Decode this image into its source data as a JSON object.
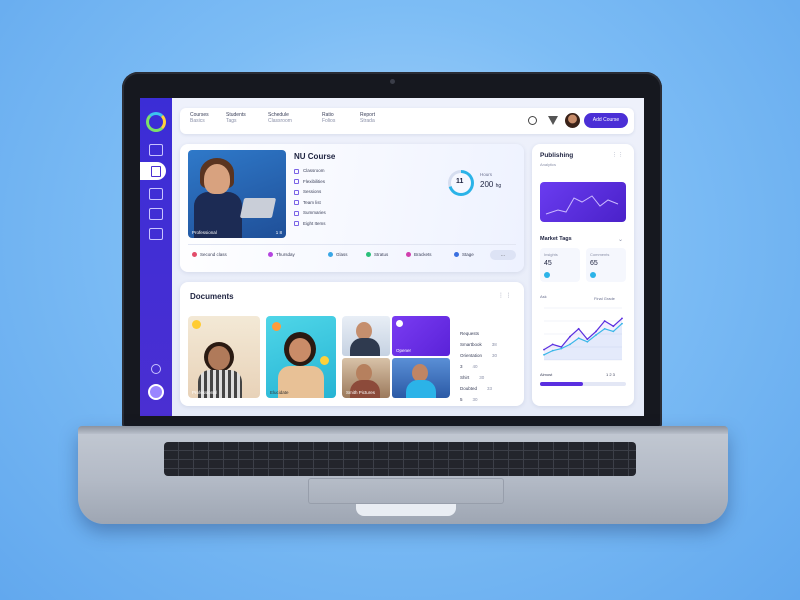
{
  "colors": {
    "background": "#7dbdf5",
    "sidebar": "#4a2fd2",
    "accent": "#4b2fd6",
    "ring": "#2bb3e8"
  },
  "topbar": {
    "nav": [
      {
        "label": "Courses",
        "sub": "Basics"
      },
      {
        "label": "Students",
        "sub": "Tags"
      },
      {
        "label": "Schedule",
        "sub": "Classroom"
      },
      {
        "label": "Ratio",
        "sub": "Folios"
      },
      {
        "label": "Report",
        "sub": "Strada"
      }
    ],
    "icons": [
      "search-icon",
      "filter-icon"
    ],
    "button_label": "Add Course"
  },
  "course": {
    "title": "NU Course",
    "photo_caption": "Professional",
    "photo_caption_right": "1 8",
    "list": [
      "Classroom",
      "Flexibilities",
      "Sessions",
      "Team list",
      "Summaries",
      "Eight Items"
    ],
    "progress_value": "11",
    "progress": 0.7,
    "stat_label": "Hours",
    "stat_value": "200",
    "stat_unit": "hg",
    "chips": [
      {
        "label": "Second class",
        "color": "#e24d6a"
      },
      {
        "label": "Thursday",
        "color": "#b545e0"
      },
      {
        "label": "Glass",
        "color": "#3aa7e6"
      },
      {
        "label": "Stratus",
        "color": "#2bc07a"
      },
      {
        "label": "Brackets",
        "color": "#d13fae"
      },
      {
        "label": "Stage",
        "color": "#3a6fe0"
      }
    ],
    "chip_more": "..."
  },
  "documents": {
    "title": "Documents",
    "thumb_captions": [
      "Professional",
      "Elucidate",
      "Smith Pictures"
    ],
    "thumb_caption_screen": "Opener",
    "list": [
      {
        "name": "Requests",
        "count": ""
      },
      {
        "name": "Smartbook",
        "count": "38"
      },
      {
        "name": "Orientation",
        "count": "30"
      },
      {
        "name": "3",
        "count": "40"
      },
      {
        "name": "Shirt",
        "count": "30"
      },
      {
        "name": "Doubted",
        "count": "33"
      },
      {
        "name": "5",
        "count": "30"
      }
    ]
  },
  "right": {
    "title": "Publishing",
    "subtitle": "Analytics",
    "section": "Market Tags",
    "stat_left": {
      "label": "Insights",
      "value": "45"
    },
    "stat_right": {
      "label": "Comments",
      "value": "65"
    },
    "chart_label": "Ask",
    "chart_legend": "Final Grade",
    "bar_label": "Almost",
    "bar_label_right": "1 2 3",
    "bar_progress": 0.5
  },
  "chart_data": {
    "type": "line",
    "title": "",
    "xlabel": "",
    "ylabel": "",
    "x": [
      1,
      2,
      3,
      4,
      5,
      6,
      7,
      8,
      9,
      10
    ],
    "series": [
      {
        "values": [
          20,
          30,
          25,
          45,
          60,
          40,
          55,
          75,
          65,
          80
        ],
        "color": "#5a2fe0"
      },
      {
        "values": [
          10,
          18,
          22,
          30,
          42,
          35,
          48,
          60,
          55,
          70
        ],
        "color": "#3ab7e8"
      }
    ],
    "ylim": [
      0,
      100
    ],
    "grid": true
  }
}
